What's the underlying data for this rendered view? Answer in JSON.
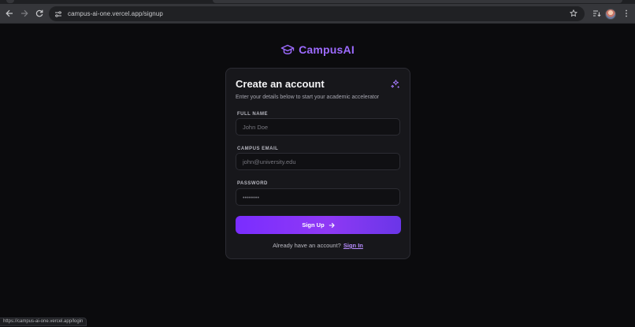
{
  "browser": {
    "url": "campus-ai-one.vercel.app/signup",
    "status_url": "https://campus-ai-one.vercel.app/login"
  },
  "brand": {
    "name": "CampusAI",
    "icon": "graduation-cap-icon",
    "color": "#9d6bff"
  },
  "form": {
    "title": "Create an account",
    "subtitle": "Enter your details below to start your academic accelerator",
    "fields": {
      "full_name": {
        "label": "FULL NAME",
        "placeholder": "John Doe",
        "value": ""
      },
      "email": {
        "label": "CAMPUS EMAIL",
        "placeholder": "john@university.edu",
        "value": ""
      },
      "password": {
        "label": "PASSWORD",
        "placeholder": "••••••••",
        "value": ""
      }
    },
    "submit_label": "Sign Up",
    "footer_text": "Already have an account?",
    "signin_label": "Sign In"
  },
  "colors": {
    "accent": "#8a2be2",
    "background": "#0b0b0d",
    "card": "#17171b"
  }
}
